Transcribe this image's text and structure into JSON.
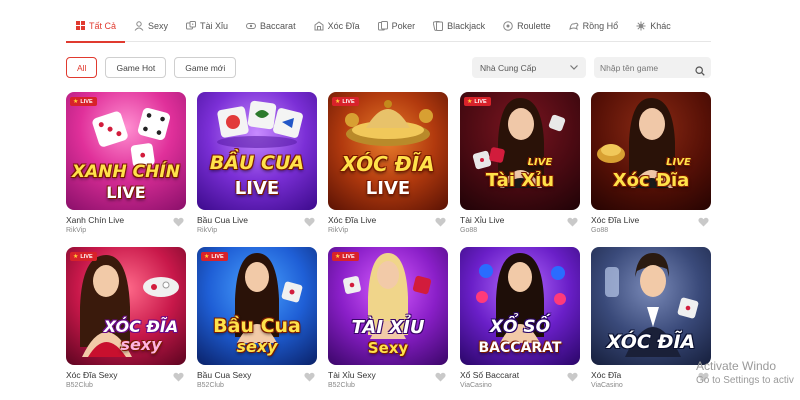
{
  "tabs": [
    {
      "label": "Tất Cả",
      "icon": "grid-icon",
      "active": true
    },
    {
      "label": "Sexy",
      "icon": "dealer-icon"
    },
    {
      "label": "Tài Xỉu",
      "icon": "dice-icon"
    },
    {
      "label": "Baccarat",
      "icon": "cards-icon"
    },
    {
      "label": "Xóc Đĩa",
      "icon": "coin-icon"
    },
    {
      "label": "Poker",
      "icon": "poker-icon"
    },
    {
      "label": "Blackjack",
      "icon": "blackjack-icon"
    },
    {
      "label": "Roulette",
      "icon": "roulette-icon"
    },
    {
      "label": "Rồng Hổ",
      "icon": "dragon-icon"
    },
    {
      "label": "Khác",
      "icon": "more-icon"
    }
  ],
  "filters": {
    "all": "All",
    "hot": "Game Hot",
    "new": "Game mới"
  },
  "provider_select": {
    "value": "Nhà Cung Cấp"
  },
  "search": {
    "placeholder": "Nhập tên game"
  },
  "badge_live": "LIVE",
  "games": [
    {
      "name": "Xanh Chín Live",
      "provider": "RikVip",
      "art_title": "XANH CHÍN",
      "art_sub": "LIVE"
    },
    {
      "name": "Bầu Cua Live",
      "provider": "RikVip",
      "art_title": "BẦU CUA",
      "art_sub": "LIVE"
    },
    {
      "name": "Xóc Đĩa Live",
      "provider": "RikVip",
      "art_title": "XÓC ĐĨA",
      "art_sub": "LIVE"
    },
    {
      "name": "Tài Xỉu Live",
      "provider": "Go88",
      "art_title": "Tài Xỉu",
      "art_sub": "LIVE"
    },
    {
      "name": "Xóc Đĩa Live",
      "provider": "Go88",
      "art_title": "Xóc Đĩa",
      "art_sub": "LIVE"
    },
    {
      "name": "Xóc Đĩa Sexy",
      "provider": "B52Club",
      "art_title": "XÓC ĐĨA",
      "art_sub": "sexy"
    },
    {
      "name": "Bầu Cua Sexy",
      "provider": "B52Club",
      "art_title": "Bầu Cua",
      "art_sub": "sexy"
    },
    {
      "name": "Tài Xỉu Sexy",
      "provider": "B52Club",
      "art_title": "TÀI XỈU",
      "art_sub": "Sexy"
    },
    {
      "name": "Xổ Số Baccarat",
      "provider": "ViaCasino",
      "art_title": "XỔ SỐ",
      "art_sub": "BACCARAT"
    },
    {
      "name": "Xóc Đĩa",
      "provider": "ViaCasino",
      "art_title": "XÓC ĐĨA",
      "art_sub": ""
    }
  ],
  "watermark": {
    "line1": "Activate Windo",
    "line2": "Go to Settings to activ"
  },
  "colors": {
    "accent": "#e03a2f",
    "live_badge": "#d8222a"
  }
}
